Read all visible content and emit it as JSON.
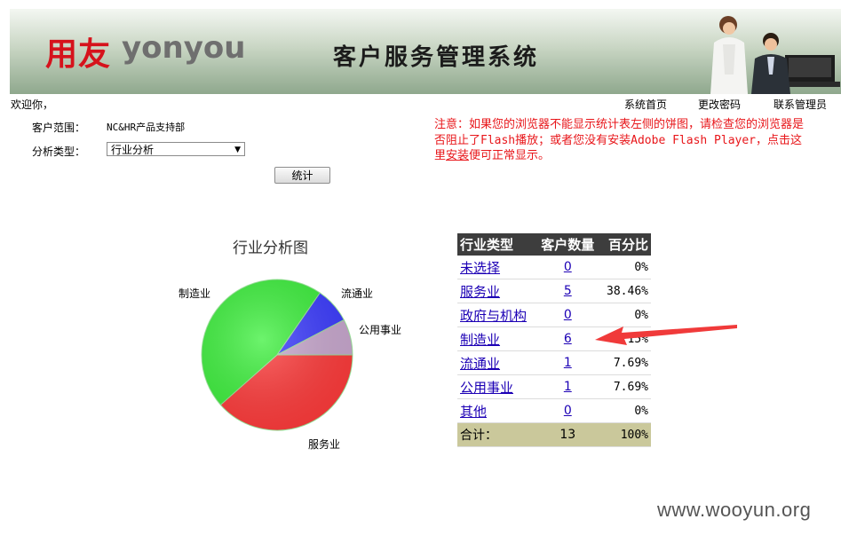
{
  "header": {
    "logo_cn": "用友",
    "logo_en": "yonyou",
    "title": "客户服务管理系统"
  },
  "topbar": {
    "welcome": "欢迎你，",
    "links": [
      "系统首页",
      "更改密码",
      "联系管理员"
    ]
  },
  "form": {
    "scope_label": "客户范围：",
    "scope_value": "NC&HR产品支持部",
    "type_label": "分析类型：",
    "type_value": "行业分析",
    "submit_label": "统计"
  },
  "notice": {
    "text_before": "注意：如果您的浏览器不能显示统计表左侧的饼图，请检查您的浏览器是否阻止了Flash播放；或者您没有安装Adobe Flash Player，点击这里",
    "link": "安装",
    "text_after": "便可正常显示。"
  },
  "chart_data": {
    "type": "pie",
    "title": "行业分析图",
    "categories": [
      "服务业",
      "制造业",
      "流通业",
      "公用事业"
    ],
    "values": [
      5,
      6,
      1,
      1
    ],
    "colors": [
      "#ff3a3a",
      "#3cf03c",
      "#3b3bff",
      "#c9a8cf"
    ]
  },
  "table": {
    "headers": [
      "行业类型",
      "客户数量",
      "百分比"
    ],
    "rows": [
      {
        "name": "未选择",
        "count": "0",
        "pct": "0%"
      },
      {
        "name": "服务业",
        "count": "5",
        "pct": "38.46%"
      },
      {
        "name": "政府与机构",
        "count": "0",
        "pct": "0%"
      },
      {
        "name": "制造业",
        "count": "6",
        "pct": "46.15%"
      },
      {
        "name": "流通业",
        "count": "1",
        "pct": "7.69%"
      },
      {
        "name": "公用事业",
        "count": "1",
        "pct": "7.69%"
      },
      {
        "name": "其他",
        "count": "0",
        "pct": "0%"
      }
    ],
    "total": {
      "label": "合计：",
      "count": "13",
      "pct": "100%"
    }
  },
  "watermark": "www.wooyun.org",
  "colors": {
    "notice": "#e8161a",
    "link": "#1c00b5",
    "table_header": "#3d3d3d",
    "total_row": "#cac89b",
    "arrow": "#f03a3a"
  }
}
